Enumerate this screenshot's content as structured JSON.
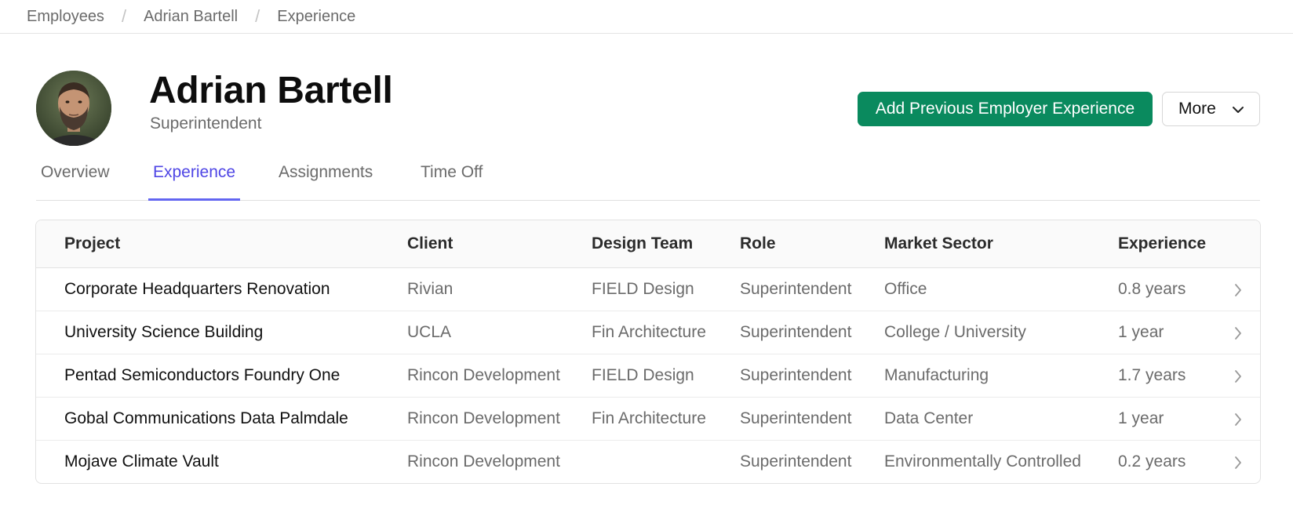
{
  "breadcrumb": [
    "Employees",
    "Adrian Bartell",
    "Experience"
  ],
  "profile": {
    "name": "Adrian Bartell",
    "title": "Superintendent"
  },
  "actions": {
    "primary_label": "Add Previous Employer Experience",
    "more_label": "More",
    "primary_color": "#0a8a5e"
  },
  "tabs": [
    {
      "label": "Overview",
      "active": false
    },
    {
      "label": "Experience",
      "active": true
    },
    {
      "label": "Assignments",
      "active": false
    },
    {
      "label": "Time Off",
      "active": false
    }
  ],
  "accent_color": "#4f46e5",
  "table": {
    "columns": [
      "Project",
      "Client",
      "Design Team",
      "Role",
      "Market Sector",
      "Experience"
    ],
    "rows": [
      {
        "project": "Corporate Headquarters Renovation",
        "client": "Rivian",
        "design_team": "FIELD Design",
        "role": "Superintendent",
        "market_sector": "Office",
        "experience": "0.8 years"
      },
      {
        "project": "University Science Building",
        "client": "UCLA",
        "design_team": "Fin Architecture",
        "role": "Superintendent",
        "market_sector": "College / University",
        "experience": "1 year"
      },
      {
        "project": "Pentad Semiconductors Foundry One",
        "client": "Rincon Development",
        "design_team": "FIELD Design",
        "role": "Superintendent",
        "market_sector": "Manufacturing",
        "experience": "1.7 years"
      },
      {
        "project": "Gobal Communications Data Palmdale",
        "client": "Rincon Development",
        "design_team": "Fin Architecture",
        "role": "Superintendent",
        "market_sector": "Data Center",
        "experience": "1 year"
      },
      {
        "project": "Mojave Climate Vault",
        "client": "Rincon Development",
        "design_team": "",
        "role": "Superintendent",
        "market_sector": "Environmentally Controlled",
        "experience": "0.2 years"
      }
    ]
  }
}
